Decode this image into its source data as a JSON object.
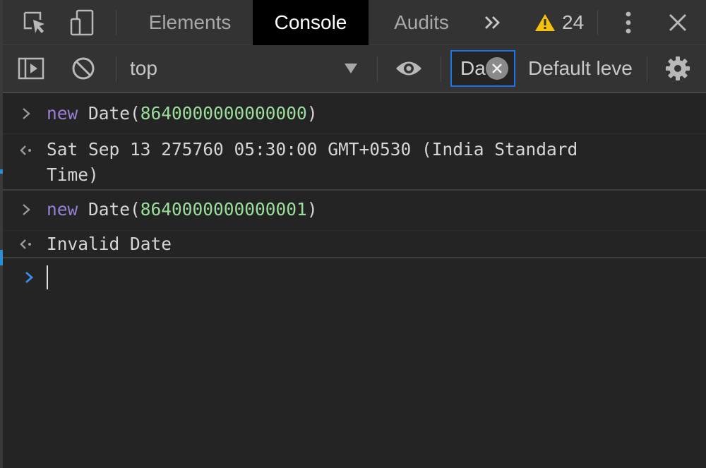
{
  "tabs": [
    {
      "label": "Elements",
      "active": false
    },
    {
      "label": "Console",
      "active": true
    },
    {
      "label": "Audits",
      "active": false
    }
  ],
  "warnings": {
    "count": "24",
    "color": "#f4c20d"
  },
  "toolbar": {
    "context": "top",
    "filter_text": "Da",
    "levels_label": "Default levels"
  },
  "console": {
    "entries": [
      {
        "type": "input",
        "keyword": "new",
        "call": "Date(",
        "arg": "8640000000000000",
        "close": ")"
      },
      {
        "type": "result",
        "line1": "Sat Sep 13 275760 05:30:00 GMT+0530 (India Standard",
        "line2": "Time)"
      },
      {
        "type": "input",
        "keyword": "new",
        "call": "Date(",
        "arg": "8640000000000001",
        "close": ")"
      },
      {
        "type": "result",
        "line1": "Invalid Date"
      }
    ],
    "prompt_color": "#3b8eea"
  },
  "colors": {
    "accent": "#1a73e8",
    "keyword": "#9a7fd6",
    "number": "#9bdf9c",
    "background": "#242424",
    "toolbar": "#333333"
  }
}
